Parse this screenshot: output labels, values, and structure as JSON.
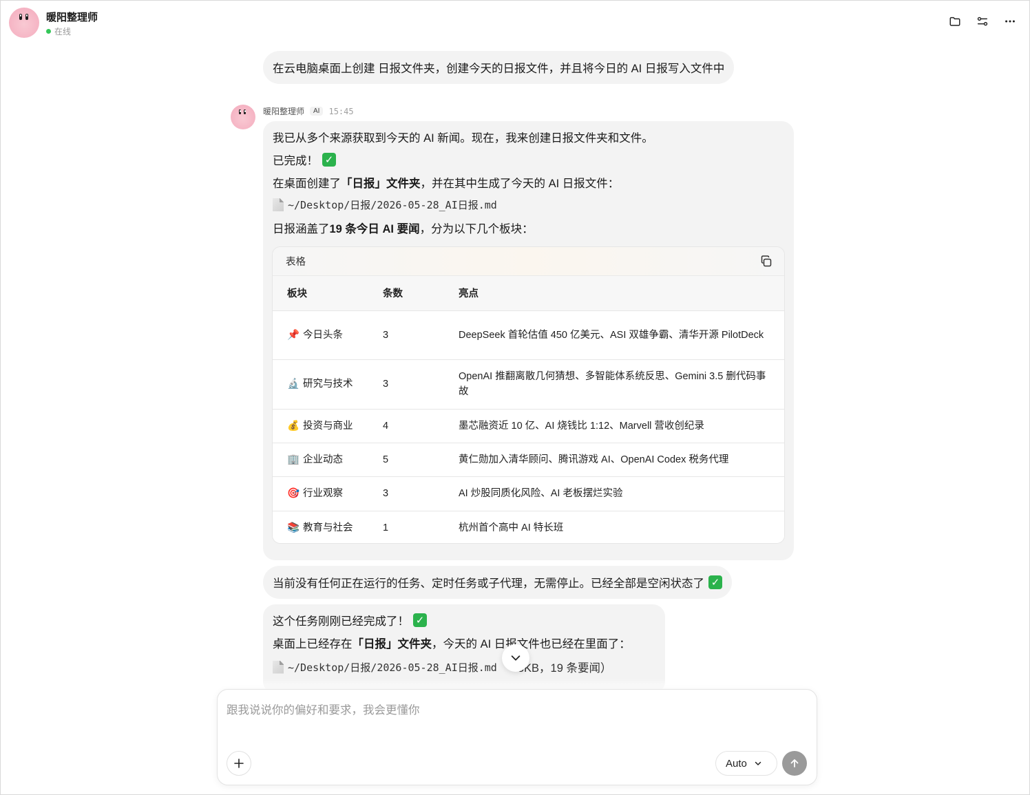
{
  "header": {
    "name": "暖阳整理师",
    "status": "在线"
  },
  "messages": {
    "user_prompt": "在云电脑桌面上创建 日报文件夹，创建今天的日报文件，并且将今日的 AI 日报写入文件中",
    "ai_name": "暖阳整理师",
    "ai_badge": "AI",
    "ai_time": "15:45",
    "reply1": {
      "line1": "我已从多个来源获取到今天的 AI 新闻。现在，我来创建日报文件夹和文件。",
      "line2": "已完成！",
      "line3_pre": "在桌面创建了 ",
      "line3_bold": "「日报」文件夹",
      "line3_post": "，并在其中生成了今天的 AI 日报文件：",
      "file_path": "~/Desktop/日报/2026-05-28_AI日报.md",
      "line5_pre": "日报涵盖了 ",
      "line5_bold": "19 条今日 AI 要闻",
      "line5_post": "，分为以下几个板块："
    },
    "table": {
      "title": "表格",
      "headers": [
        "板块",
        "条数",
        "亮点"
      ],
      "rows": [
        {
          "icon": "📌",
          "section": "今日头条",
          "count": "3",
          "highlight": "DeepSeek 首轮估值 450 亿美元、ASI 双雄争霸、清华开源 PilotDeck"
        },
        {
          "icon": "🔬",
          "section": "研究与技术",
          "count": "3",
          "highlight": "OpenAI 推翻离散几何猜想、多智能体系统反思、Gemini 3.5 删代码事故"
        },
        {
          "icon": "💰",
          "section": "投资与商业",
          "count": "4",
          "highlight": "墨芯融资近 10 亿、AI 烧钱比 1:12、Marvell 营收创纪录"
        },
        {
          "icon": "🏢",
          "section": "企业动态",
          "count": "5",
          "highlight": "黄仁勋加入清华顾问、腾讯游戏 AI、OpenAI Codex 税务代理"
        },
        {
          "icon": "🎯",
          "section": "行业观察",
          "count": "3",
          "highlight": "AI 炒股同质化风险、AI 老板摆烂实验"
        },
        {
          "icon": "📚",
          "section": "教育与社会",
          "count": "1",
          "highlight": "杭州首个高中 AI 特长班"
        }
      ]
    },
    "reply2": "当前没有任何正在运行的任务、定时任务或子代理，无需停止。已经全部是空闲状态了",
    "reply3": {
      "line1": "这个任务刚刚已经完成了！",
      "line2_pre": "桌面上已经存在 ",
      "line2_bold": "「日报」文件夹",
      "line2_post": "，今天的 AI 日报文件也已经在里面了：",
      "file_path": "~/Desktop/日报/2026-05-28_AI日报.md",
      "file_suffix": "3KB，19 条要闻）"
    }
  },
  "composer": {
    "placeholder": "跟我说说你的偏好和要求，我会更懂你",
    "mode": "Auto"
  },
  "colors": {
    "bubble_bg": "#f3f3f3",
    "online_green": "#34c759",
    "check_green": "#2bb24c",
    "send_disabled": "#9a9a9a"
  },
  "icons": [
    "folder-icon",
    "connections-icon",
    "more-icon",
    "copy-icon",
    "chevron-down-icon",
    "plus-icon",
    "arrow-up-icon",
    "file-icon",
    "check-icon"
  ]
}
